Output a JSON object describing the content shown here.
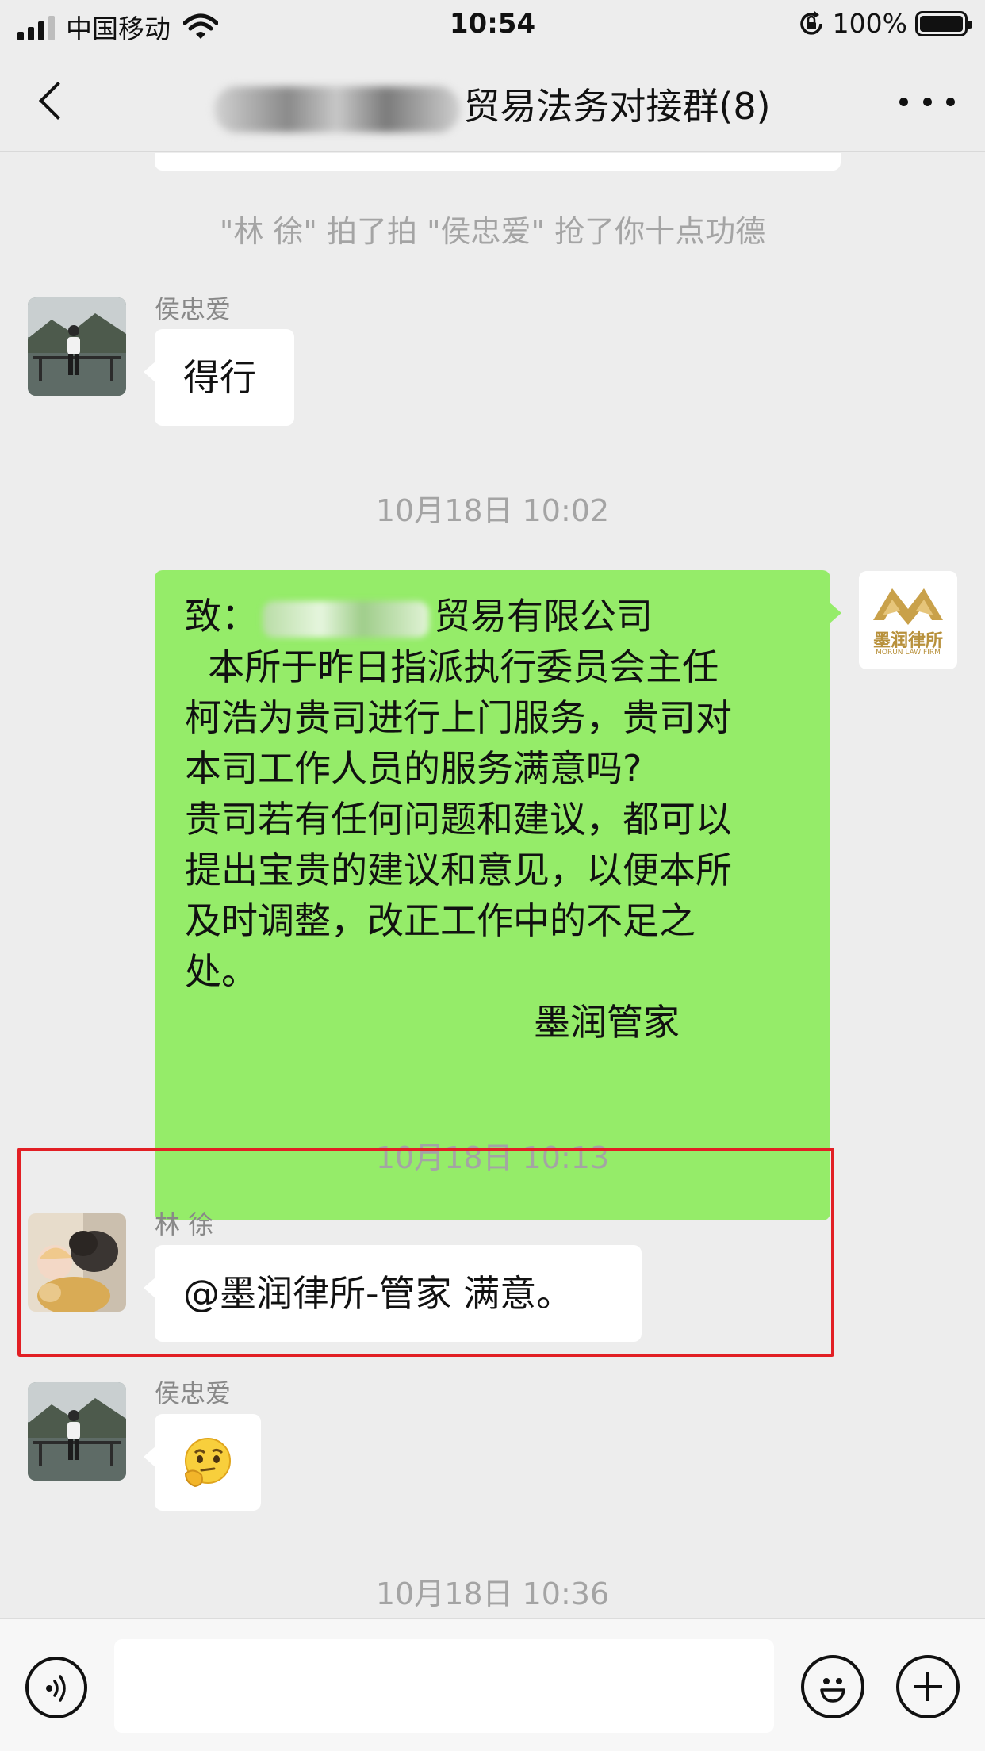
{
  "status_bar": {
    "carrier": "中国移动",
    "time": "10:54",
    "battery": "100%",
    "icons": [
      "signal-icon",
      "wifi-icon",
      "rotation-lock-icon",
      "battery-icon"
    ]
  },
  "header": {
    "title_visible": "贸易法务对接群(8)",
    "icons": [
      "back-icon",
      "more-icon"
    ]
  },
  "messages": {
    "system_notice": "\"林  徐\" 拍了拍 \"侯忠爱\" 抢了你十点功德",
    "m1": {
      "sender": "侯忠爱",
      "text": "得行"
    },
    "time1": "10月18日 10:02",
    "m2": {
      "line1_prefix": "致：",
      "line1_suffix": "贸易有限公司",
      "line2": "  本所于昨日指派执行委员会主任",
      "line3": "柯浩为贵司进行上门服务，贵司对",
      "line4": "本司工作人员的服务满意吗?",
      "line5": "贵司若有任何问题和建议，都可以",
      "line6": "提出宝贵的建议和意见，以便本所",
      "line7": "及时调整，改正工作中的不足之",
      "line8": "处。",
      "signature": "墨润管家",
      "avatar_text": "墨润律所",
      "avatar_subtext": "MORUN LAW FIRM"
    },
    "time2": "10月18日 10:13",
    "m3": {
      "sender": "林  徐",
      "text": "@墨润律所-管家 满意。"
    },
    "m4": {
      "sender": "侯忠爱",
      "emoji": "thinking-face-emoji"
    },
    "time3": "10月18日 10:36"
  },
  "colors": {
    "background": "#ededed",
    "sent_bubble": "#95ec69",
    "received_bubble": "#ffffff",
    "highlight": "#e21f24",
    "timestamp": "#a4a4a4"
  }
}
